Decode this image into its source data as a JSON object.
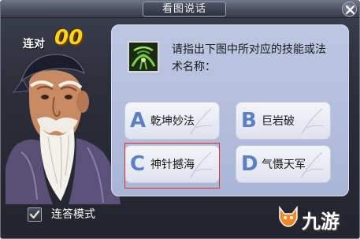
{
  "window": {
    "title": "看图说话",
    "close_label": "close"
  },
  "streak": {
    "label": "连对",
    "count": "00"
  },
  "question": {
    "text": "请指出下图中所对应的技能或法术名称："
  },
  "answers": [
    {
      "letter": "A",
      "text": "乾坤妙法"
    },
    {
      "letter": "B",
      "text": "巨岩破"
    },
    {
      "letter": "C",
      "text": "神针撼海"
    },
    {
      "letter": "D",
      "text": "气慑天军"
    }
  ],
  "continuous_mode": {
    "label": "连答模式",
    "checked": true
  },
  "watermark": {
    "text": "九游"
  },
  "colors": {
    "panel_bg": "#b4c0de",
    "streak_count": "#ffd31a",
    "answer_letter": "#5c7fc4",
    "highlight_border": "#e0302a"
  }
}
